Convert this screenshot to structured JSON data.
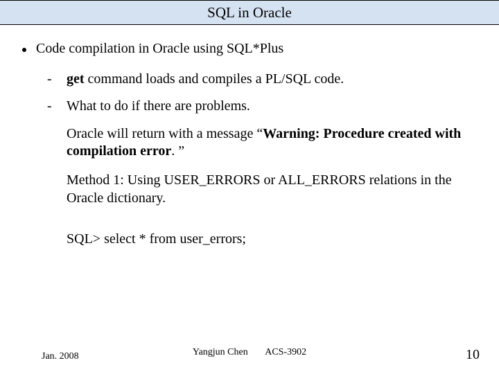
{
  "title": "SQL in Oracle",
  "bullet": {
    "main": "Code compilation in Oracle using SQL*Plus",
    "sub1_prefix": "get",
    "sub1_rest": " command loads and compiles a PL/SQL code.",
    "sub2": "What to do if there are problems.",
    "para1_a": "Oracle will return with a message “",
    "para1_b": "Warning: Procedure created with compilation error",
    "para1_c": ". ”",
    "para2": "Method 1: Using USER_ERRORS or ALL_ERRORS relations in the Oracle dictionary.",
    "sql": "SQL> select * from user_errors;"
  },
  "footer": {
    "date": "Jan. 2008",
    "center": "Yangjun Chen       ACS-3902",
    "page": "10"
  }
}
